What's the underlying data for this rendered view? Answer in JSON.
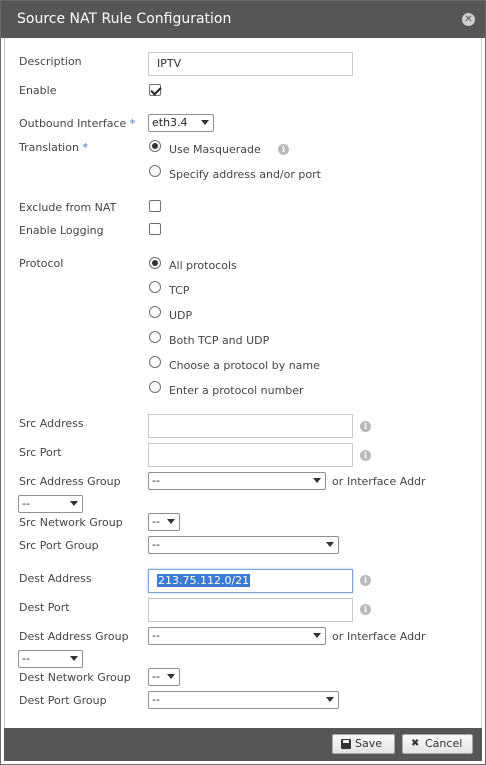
{
  "dialog": {
    "title": "Source NAT Rule Configuration",
    "close_glyph": "✕"
  },
  "form": {
    "description": {
      "label": "Description",
      "value": "IPTV"
    },
    "enable": {
      "label": "Enable",
      "checked": true
    },
    "outbound_interface": {
      "label": "Outbound Interface",
      "required_mark": "*",
      "value": "eth3.4"
    },
    "translation": {
      "label": "Translation",
      "required_mark": "*",
      "options": [
        "Use Masquerade",
        "Specify address and/or port"
      ],
      "selected": 0
    },
    "exclude_from_nat": {
      "label": "Exclude from NAT",
      "checked": false
    },
    "enable_logging": {
      "label": "Enable Logging",
      "checked": false
    },
    "protocol": {
      "label": "Protocol",
      "options": [
        "All protocols",
        "TCP",
        "UDP",
        "Both TCP and UDP",
        "Choose a protocol by name",
        "Enter a protocol number"
      ],
      "selected": 0
    },
    "src_address": {
      "label": "Src Address",
      "value": ""
    },
    "src_port": {
      "label": "Src Port",
      "value": ""
    },
    "src_address_group": {
      "label": "Src Address Group",
      "value": "--",
      "or_text": "or",
      "interface_addr_label": "Interface Addr",
      "interface_addr_value": "--"
    },
    "src_network_group": {
      "label": "Src Network Group",
      "value": "--"
    },
    "src_port_group": {
      "label": "Src Port Group",
      "value": "--"
    },
    "dest_address": {
      "label": "Dest Address",
      "value": "213.75.112.0/21"
    },
    "dest_port": {
      "label": "Dest Port",
      "value": ""
    },
    "dest_address_group": {
      "label": "Dest Address Group",
      "value": "--",
      "or_text": "or",
      "interface_addr_label": "Interface Addr",
      "interface_addr_value": "--"
    },
    "dest_network_group": {
      "label": "Dest Network Group",
      "value": "--"
    },
    "dest_port_group": {
      "label": "Dest Port Group",
      "value": "--"
    }
  },
  "footer": {
    "save_label": "Save",
    "cancel_label": "Cancel"
  },
  "colors": {
    "titlebar": "#565656",
    "required": "#3a7bd5",
    "selection": "#3c7bd2"
  },
  "icons": {
    "info": "i",
    "cancel": "✖"
  }
}
